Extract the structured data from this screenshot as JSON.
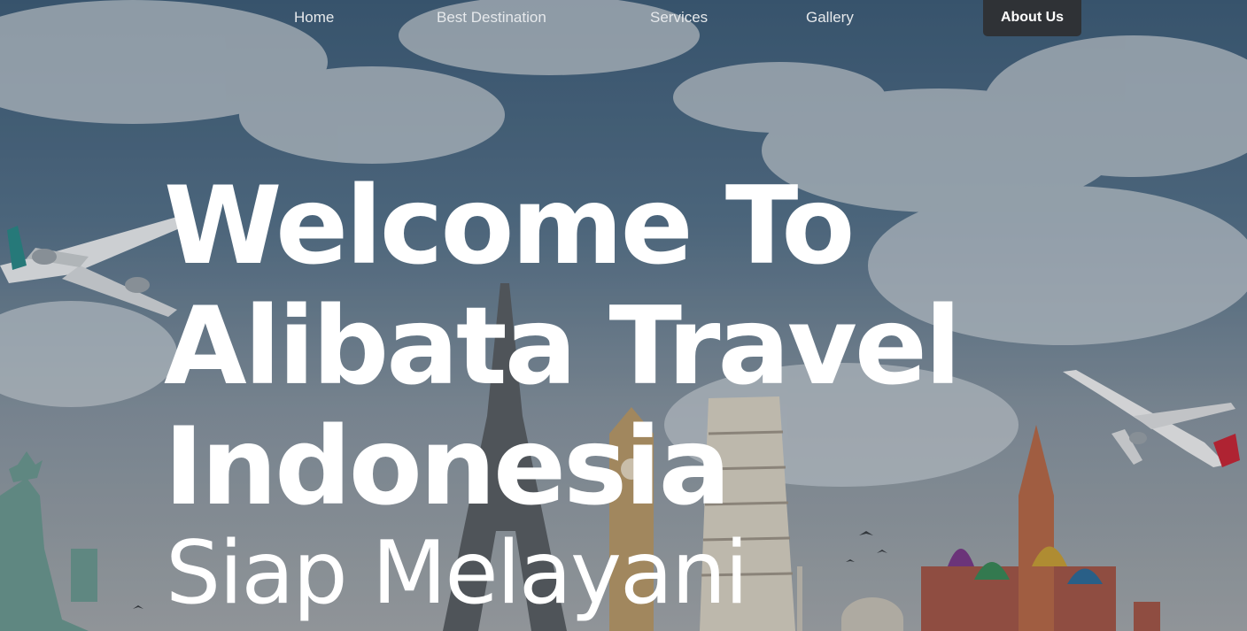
{
  "nav": {
    "items": [
      {
        "label": "Home"
      },
      {
        "label": "Best Destination"
      },
      {
        "label": "Services"
      },
      {
        "label": "Gallery"
      },
      {
        "label": "About Us",
        "active": true
      }
    ],
    "active_bg": "#2f3236"
  },
  "hero": {
    "headline_lines": [
      "Welcome To",
      "Alibata Travel",
      "Indonesia"
    ],
    "subline": "Siap Melayani",
    "background_image": "travel-landmarks-collage"
  }
}
